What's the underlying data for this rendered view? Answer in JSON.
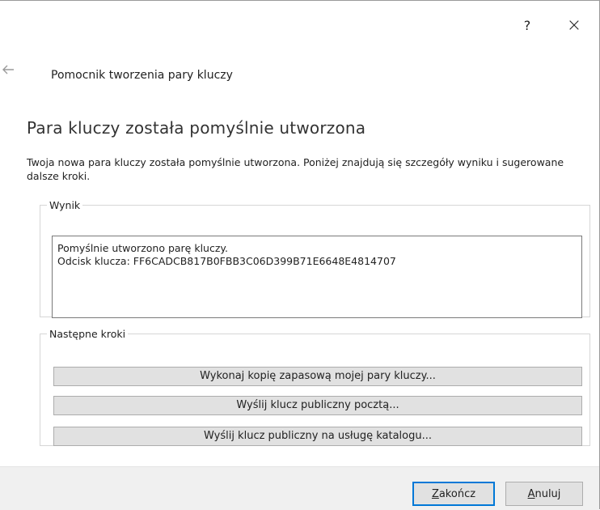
{
  "window": {
    "help_label": "?",
    "close_label": "×"
  },
  "header": {
    "back_icon": "back-arrow-icon",
    "wizard_title": "Pomocnik tworzenia pary kluczy"
  },
  "main": {
    "page_title": "Para kluczy została pomyślnie utworzona",
    "intro_text": "Twoja nowa para kluczy została pomyślnie utworzona. Poniżej znajdują się szczegóły wyniku i sugerowane dalsze kroki."
  },
  "result_group": {
    "legend": "Wynik",
    "line1": "Pomyślnie utworzono parę kluczy.",
    "line2": "Odcisk klucza: FF6CADCB817B0FBB3C06D399B71E6648E4814707"
  },
  "next_steps_group": {
    "legend": "Następne kroki",
    "buttons": [
      "Wykonaj kopię zapasową mojej pary kluczy...",
      "Wyślij klucz publiczny pocztą...",
      "Wyślij klucz publiczny na usługę katalogu..."
    ]
  },
  "footer": {
    "finish_prefix": "Z",
    "finish_rest": "akończ",
    "cancel_prefix": "A",
    "cancel_rest": "nuluj"
  },
  "colors": {
    "footer_bg": "#f0f0f0",
    "button_bg": "#e1e1e1",
    "default_button_border": "#0078d7"
  }
}
